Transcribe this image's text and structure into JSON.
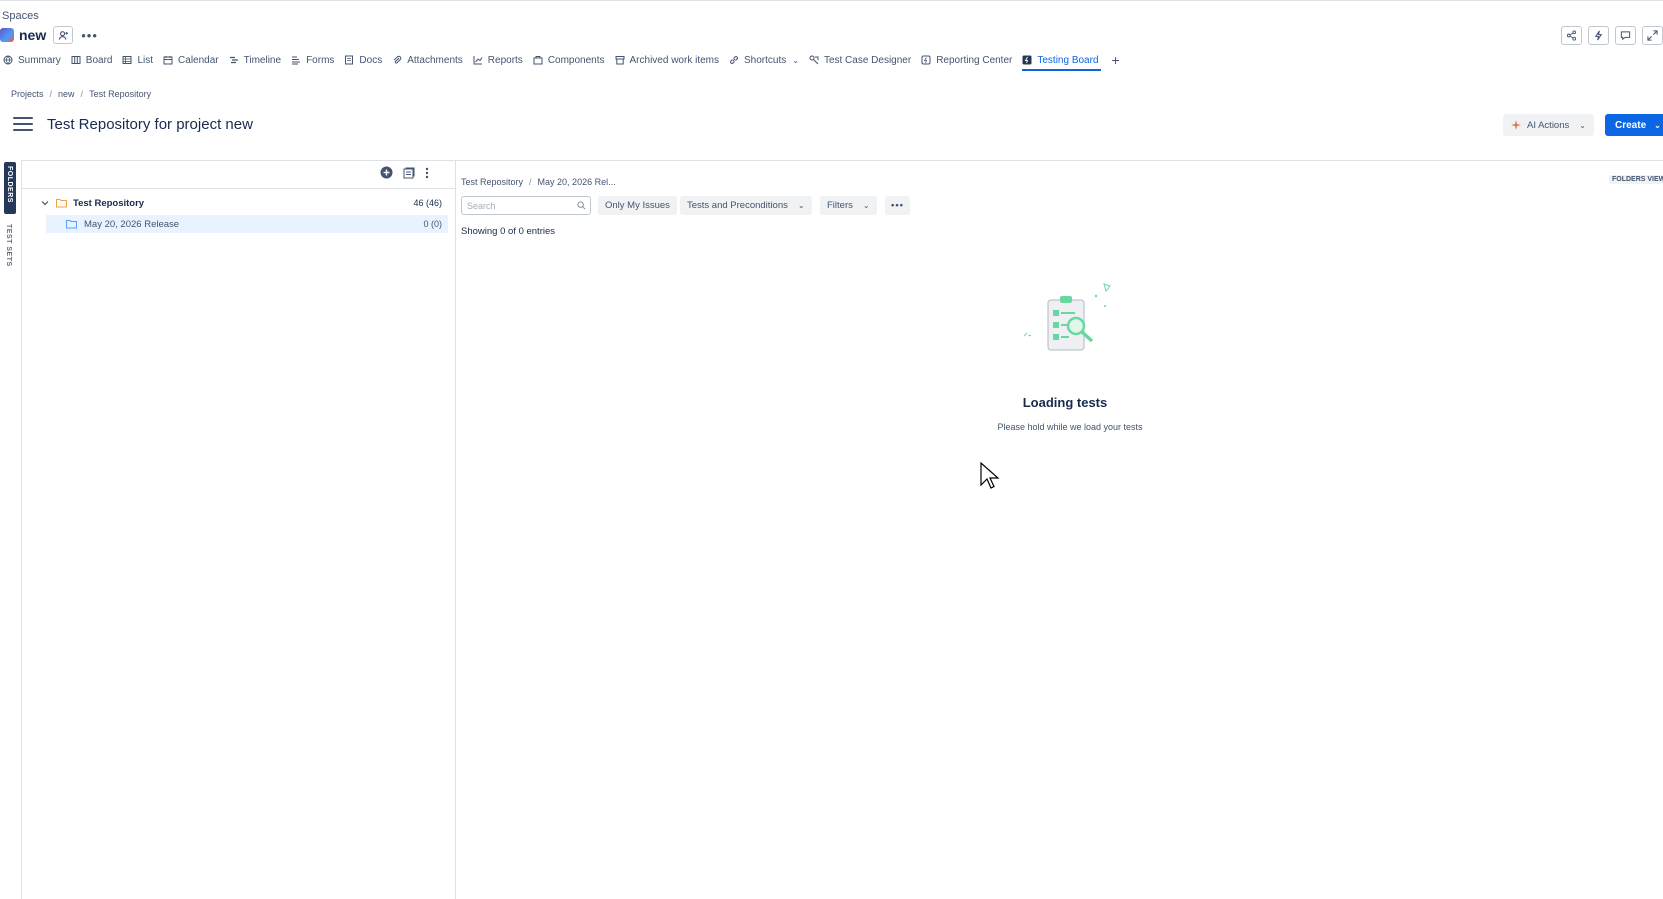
{
  "header": {
    "spaces_label": "Spaces",
    "project_name": "new"
  },
  "tabs": [
    {
      "label": "Summary",
      "icon": "globe-icon"
    },
    {
      "label": "Board",
      "icon": "board-icon"
    },
    {
      "label": "List",
      "icon": "list-icon"
    },
    {
      "label": "Calendar",
      "icon": "calendar-icon"
    },
    {
      "label": "Timeline",
      "icon": "timeline-icon"
    },
    {
      "label": "Forms",
      "icon": "forms-icon"
    },
    {
      "label": "Docs",
      "icon": "docs-icon"
    },
    {
      "label": "Attachments",
      "icon": "paperclip-icon"
    },
    {
      "label": "Reports",
      "icon": "chart-icon"
    },
    {
      "label": "Components",
      "icon": "components-icon"
    },
    {
      "label": "Archived work items",
      "icon": "archive-icon"
    },
    {
      "label": "Shortcuts",
      "icon": "link-icon"
    },
    {
      "label": "Test Case Designer",
      "icon": "designer-icon"
    },
    {
      "label": "Reporting Center",
      "icon": "app-icon"
    },
    {
      "label": "Testing Board",
      "icon": "app-icon",
      "active": true
    }
  ],
  "breadcrumb": [
    "Projects",
    "new",
    "Test Repository"
  ],
  "page": {
    "title": "Test Repository for project new",
    "ai_actions_label": "AI Actions",
    "create_label": "Create"
  },
  "side_tabs": {
    "folders": "FOLDERS",
    "test_sets": "TEST SETS"
  },
  "tree": {
    "root_label": "Test Repository",
    "root_count": "46 (46)",
    "child_label": "May 20, 2026 Release",
    "child_count": "0 (0)"
  },
  "right_panel": {
    "breadcrumb_root": "Test Repository",
    "breadcrumb_current": "May 20, 2026 Rel...",
    "folders_view": "FOLDERS VIEW",
    "search_placeholder": "Search",
    "only_my_issues": "Only My Issues",
    "tests_and_preconditions": "Tests and Preconditions",
    "filters": "Filters",
    "showing": "Showing 0 of 0 entries",
    "loading_title": "Loading tests",
    "loading_subtitle": "Please hold while we load your tests"
  },
  "colors": {
    "accent": "#0c66e4",
    "text": "#172b4d",
    "muted": "#44546f",
    "illustration_green": "#6bd7a0"
  }
}
